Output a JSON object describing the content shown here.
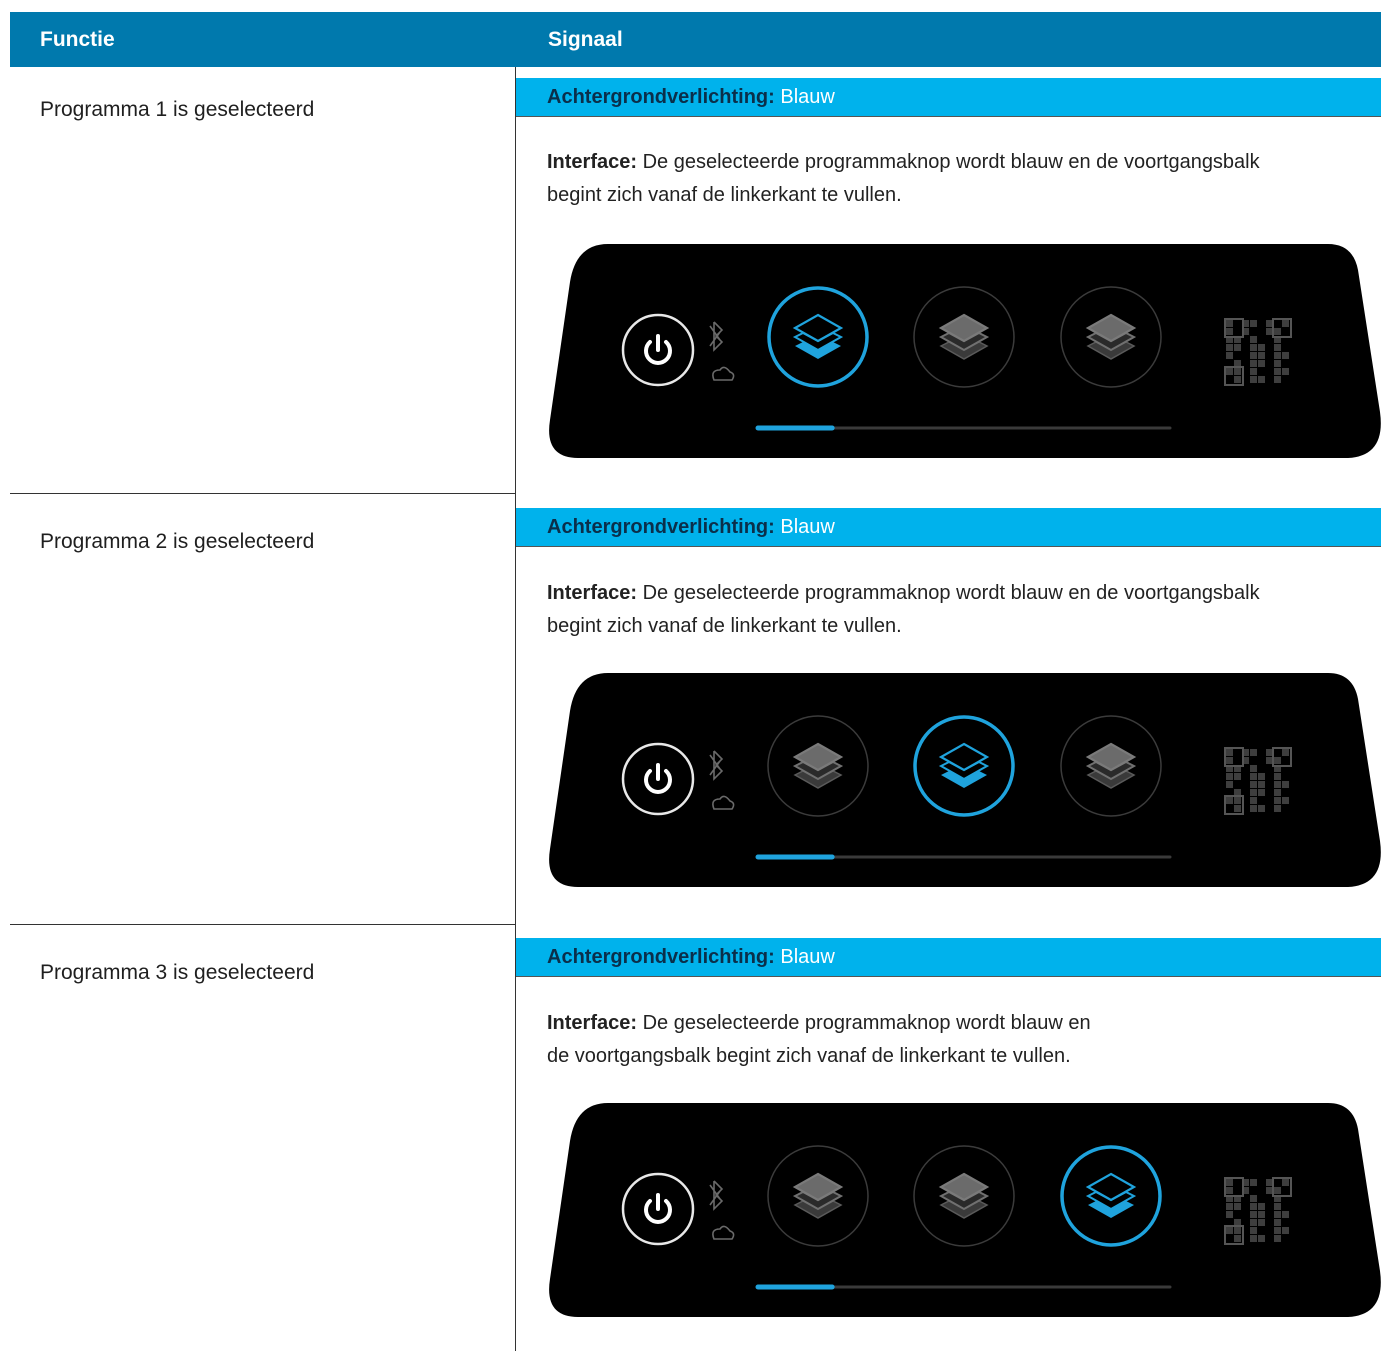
{
  "header": {
    "col_function": "Functie",
    "col_signal": "Signaal"
  },
  "rows": [
    {
      "function": "Programma 1 is geselecteerd",
      "background_key": "Achtergrondverlichting:",
      "background_value": "Blauw",
      "interface_key": "Interface:",
      "interface_line1": "De geselecteerde programmaknop wordt blauw en de voortgangsbalk",
      "interface_line2": "begint zich vanaf de linkerkant te vullen.",
      "selected_program": 1,
      "progress_fraction": 0.18
    },
    {
      "function": "Programma 2 is geselecteerd",
      "background_key": "Achtergrondverlichting:",
      "background_value": "Blauw",
      "interface_key": "Interface:",
      "interface_line1": "De geselecteerde programmaknop wordt blauw en de voortgangsbalk",
      "interface_line2": "begint zich vanaf de linkerkant te vullen.",
      "selected_program": 2,
      "progress_fraction": 0.18
    },
    {
      "function": "Programma 3 is geselecteerd",
      "background_key": "Achtergrondverlichting:",
      "background_value": "Blauw",
      "interface_key": "Interface:",
      "interface_line1": "De geselecteerde programmaknop wordt blauw en",
      "interface_line2": "de voortgangsbalk begint zich vanaf de linkerkant te vullen.",
      "selected_program": 3,
      "progress_fraction": 0.18
    }
  ],
  "colors": {
    "header_bg": "#0079ad",
    "band_bg": "#00b2ec",
    "accent_blue": "#1fa3dd",
    "panel_bg": "#000000"
  },
  "icons": [
    "power-icon",
    "bluetooth-icon",
    "cloud-icon",
    "layers-icon",
    "qr-code-icon"
  ]
}
